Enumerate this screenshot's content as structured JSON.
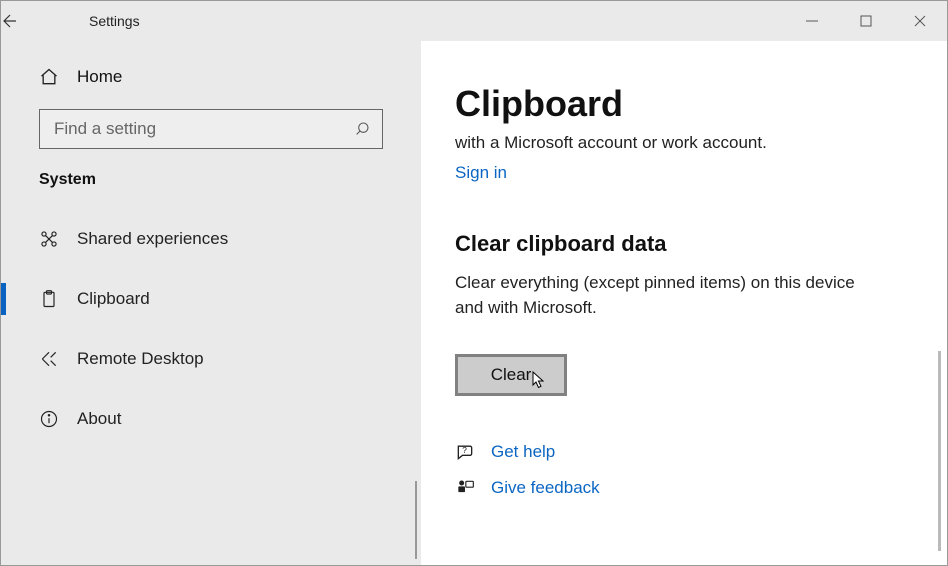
{
  "window": {
    "app_title": "Settings"
  },
  "sidebar": {
    "home_label": "Home",
    "search_placeholder": "Find a setting",
    "category": "System",
    "items": [
      {
        "key": "shared-experiences",
        "label": "Shared experiences"
      },
      {
        "key": "clipboard",
        "label": "Clipboard"
      },
      {
        "key": "remote-desktop",
        "label": "Remote Desktop"
      },
      {
        "key": "about",
        "label": "About"
      }
    ]
  },
  "main": {
    "title": "Clipboard",
    "subtitle": "with a Microsoft account or work account.",
    "signin_label": "Sign in",
    "section_title": "Clear clipboard data",
    "section_desc": "Clear everything (except pinned items) on this device and with Microsoft.",
    "clear_button": "Clear",
    "get_help_label": "Get help",
    "give_feedback_label": "Give feedback"
  }
}
